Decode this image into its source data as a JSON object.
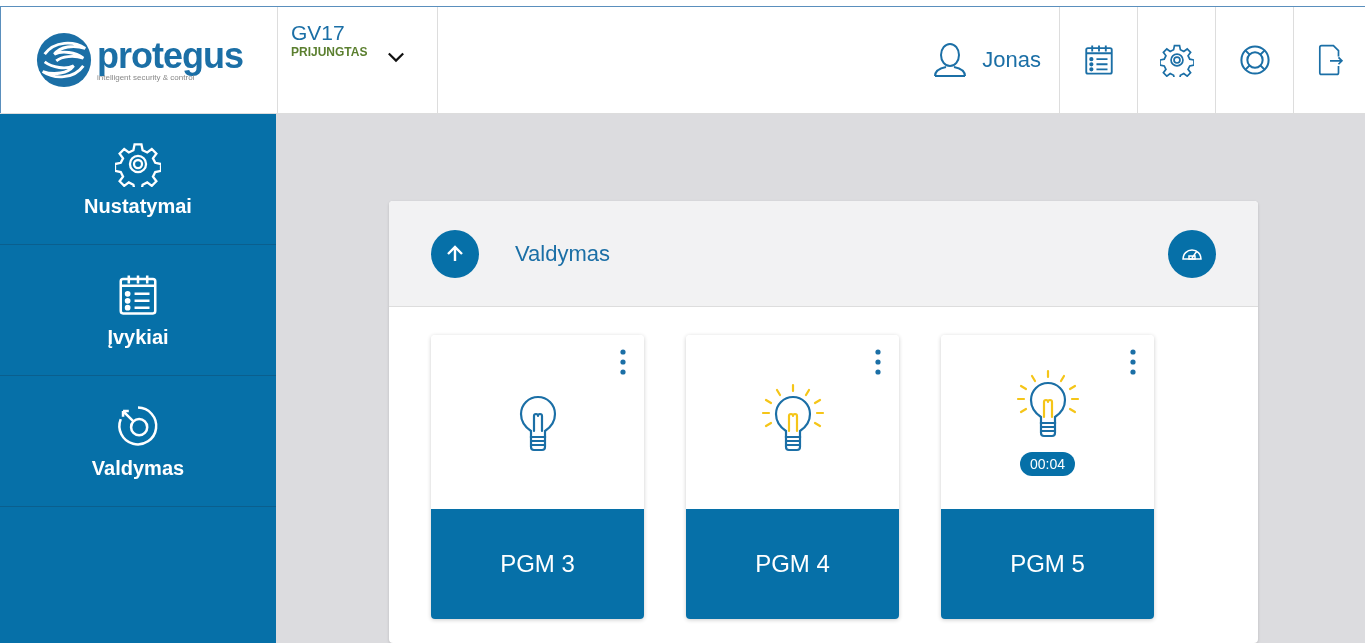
{
  "logo": {
    "name": "protegus",
    "tagline": "intelligent security & control"
  },
  "device": {
    "name": "GV17",
    "status": "PRIJUNGTAS"
  },
  "user": {
    "name": "Jonas"
  },
  "sidebar": {
    "items": [
      {
        "label": "Nustatymai",
        "kind": "settings"
      },
      {
        "label": "Įvykiai",
        "kind": "events"
      },
      {
        "label": "Valdymas",
        "kind": "control"
      }
    ]
  },
  "panel": {
    "title": "Valdymas"
  },
  "pgms": [
    {
      "label": "PGM 3",
      "on": false
    },
    {
      "label": "PGM 4",
      "on": true
    },
    {
      "label": "PGM 5",
      "on": true,
      "timer": "00:04"
    }
  ]
}
